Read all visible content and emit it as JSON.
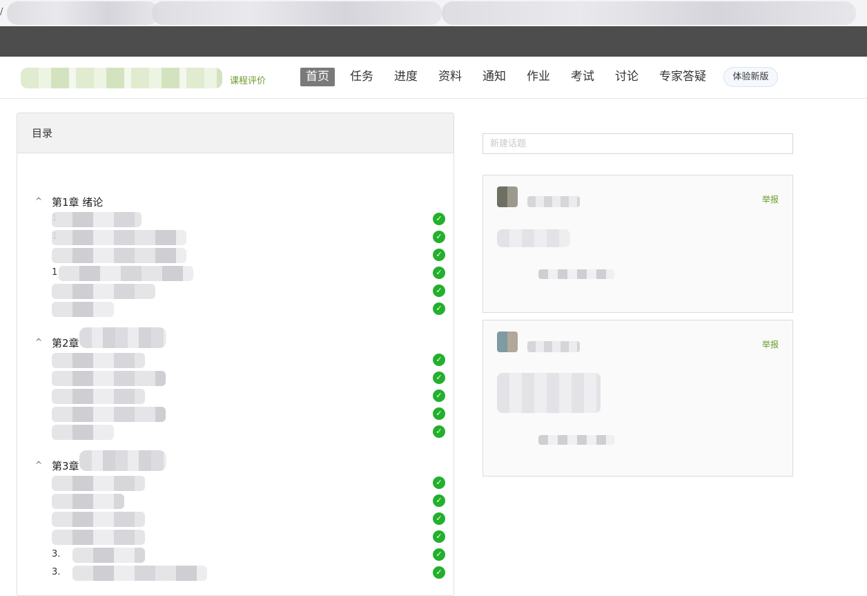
{
  "nav": {
    "course_eval": "课程评价",
    "tabs": [
      "首页",
      "任务",
      "进度",
      "资料",
      "通知",
      "作业",
      "考试",
      "讨论",
      "专家答疑"
    ],
    "active_tab": "首页",
    "new_version": "体验新版"
  },
  "catalog": {
    "title": "目录",
    "chapters": [
      {
        "title": "第1章 绪论",
        "lesson_prefixes": [
          "1",
          "1",
          "",
          "1",
          "",
          ""
        ],
        "completed": [
          true,
          true,
          true,
          true,
          true,
          true
        ]
      },
      {
        "title": "第2章",
        "lesson_prefixes": [
          "",
          "",
          "",
          "",
          ""
        ],
        "completed": [
          true,
          true,
          true,
          true,
          true
        ]
      },
      {
        "title": "第3章",
        "lesson_prefixes": [
          "",
          "",
          "",
          "",
          "3.",
          "3."
        ],
        "completed": [
          true,
          true,
          true,
          true,
          true,
          true
        ]
      }
    ]
  },
  "discussion": {
    "new_topic_placeholder": "新建话题",
    "report_label": "举报"
  },
  "colors": {
    "accent_green": "#6c9a2c",
    "check_green": "#23b02c",
    "dark_bar": "#4d4d4d"
  },
  "icons": {
    "chapter_toggle": "chevron-up-icon",
    "lesson_done": "check-circle-icon"
  }
}
